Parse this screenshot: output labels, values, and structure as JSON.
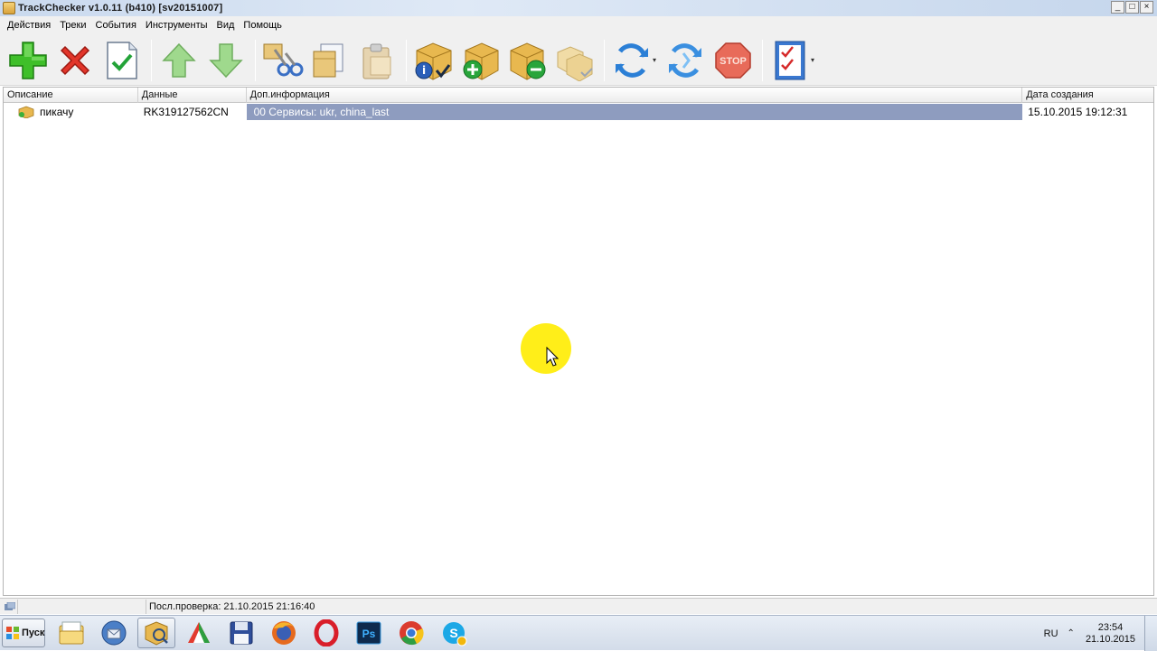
{
  "window": {
    "title": "TrackChecker v1.0.11 (b410)  [sv20151007]",
    "buttons": {
      "minimize": "_",
      "maximize": "□",
      "close": "×"
    }
  },
  "menu": [
    "Действия",
    "Треки",
    "События",
    "Инструменты",
    "Вид",
    "Помощь"
  ],
  "toolbar": {
    "buttons": [
      "add-icon",
      "delete-icon",
      "check-icon",
      "move-up-icon",
      "move-down-icon",
      "cut-icon",
      "copy-icon",
      "paste-icon",
      "package-info-icon",
      "package-add-icon",
      "package-remove-icon",
      "package-multi-icon",
      "refresh-icon",
      "refresh-all-icon",
      "stop-icon",
      "checklist-icon"
    ],
    "stop_label": "STOP"
  },
  "list": {
    "columns": [
      "Описание",
      "Данные",
      "Доп.информация",
      "Дата создания"
    ],
    "rows": [
      {
        "description": "пикачу",
        "data": "RK319127562CN",
        "info": "00 Сервисы: ukr, china_last",
        "created": "15.10.2015 19:12:31"
      }
    ]
  },
  "status": {
    "last_check": "Посл.проверка: 21.10.2015 21:16:40"
  },
  "taskbar": {
    "start_label": "Пуск",
    "apps": [
      "explorer-icon",
      "thunderbird-icon",
      "trackchecker-icon",
      "media-icon",
      "save-icon",
      "firefox-icon",
      "opera-icon",
      "photoshop-icon",
      "chrome-icon",
      "skype-icon"
    ],
    "photoshop_label": "Ps",
    "language": "RU",
    "time": "23:54",
    "date": "21.10.2015"
  },
  "colors": {
    "selection": "#8e9cbf",
    "cursor_highlight": "#ffec00"
  }
}
